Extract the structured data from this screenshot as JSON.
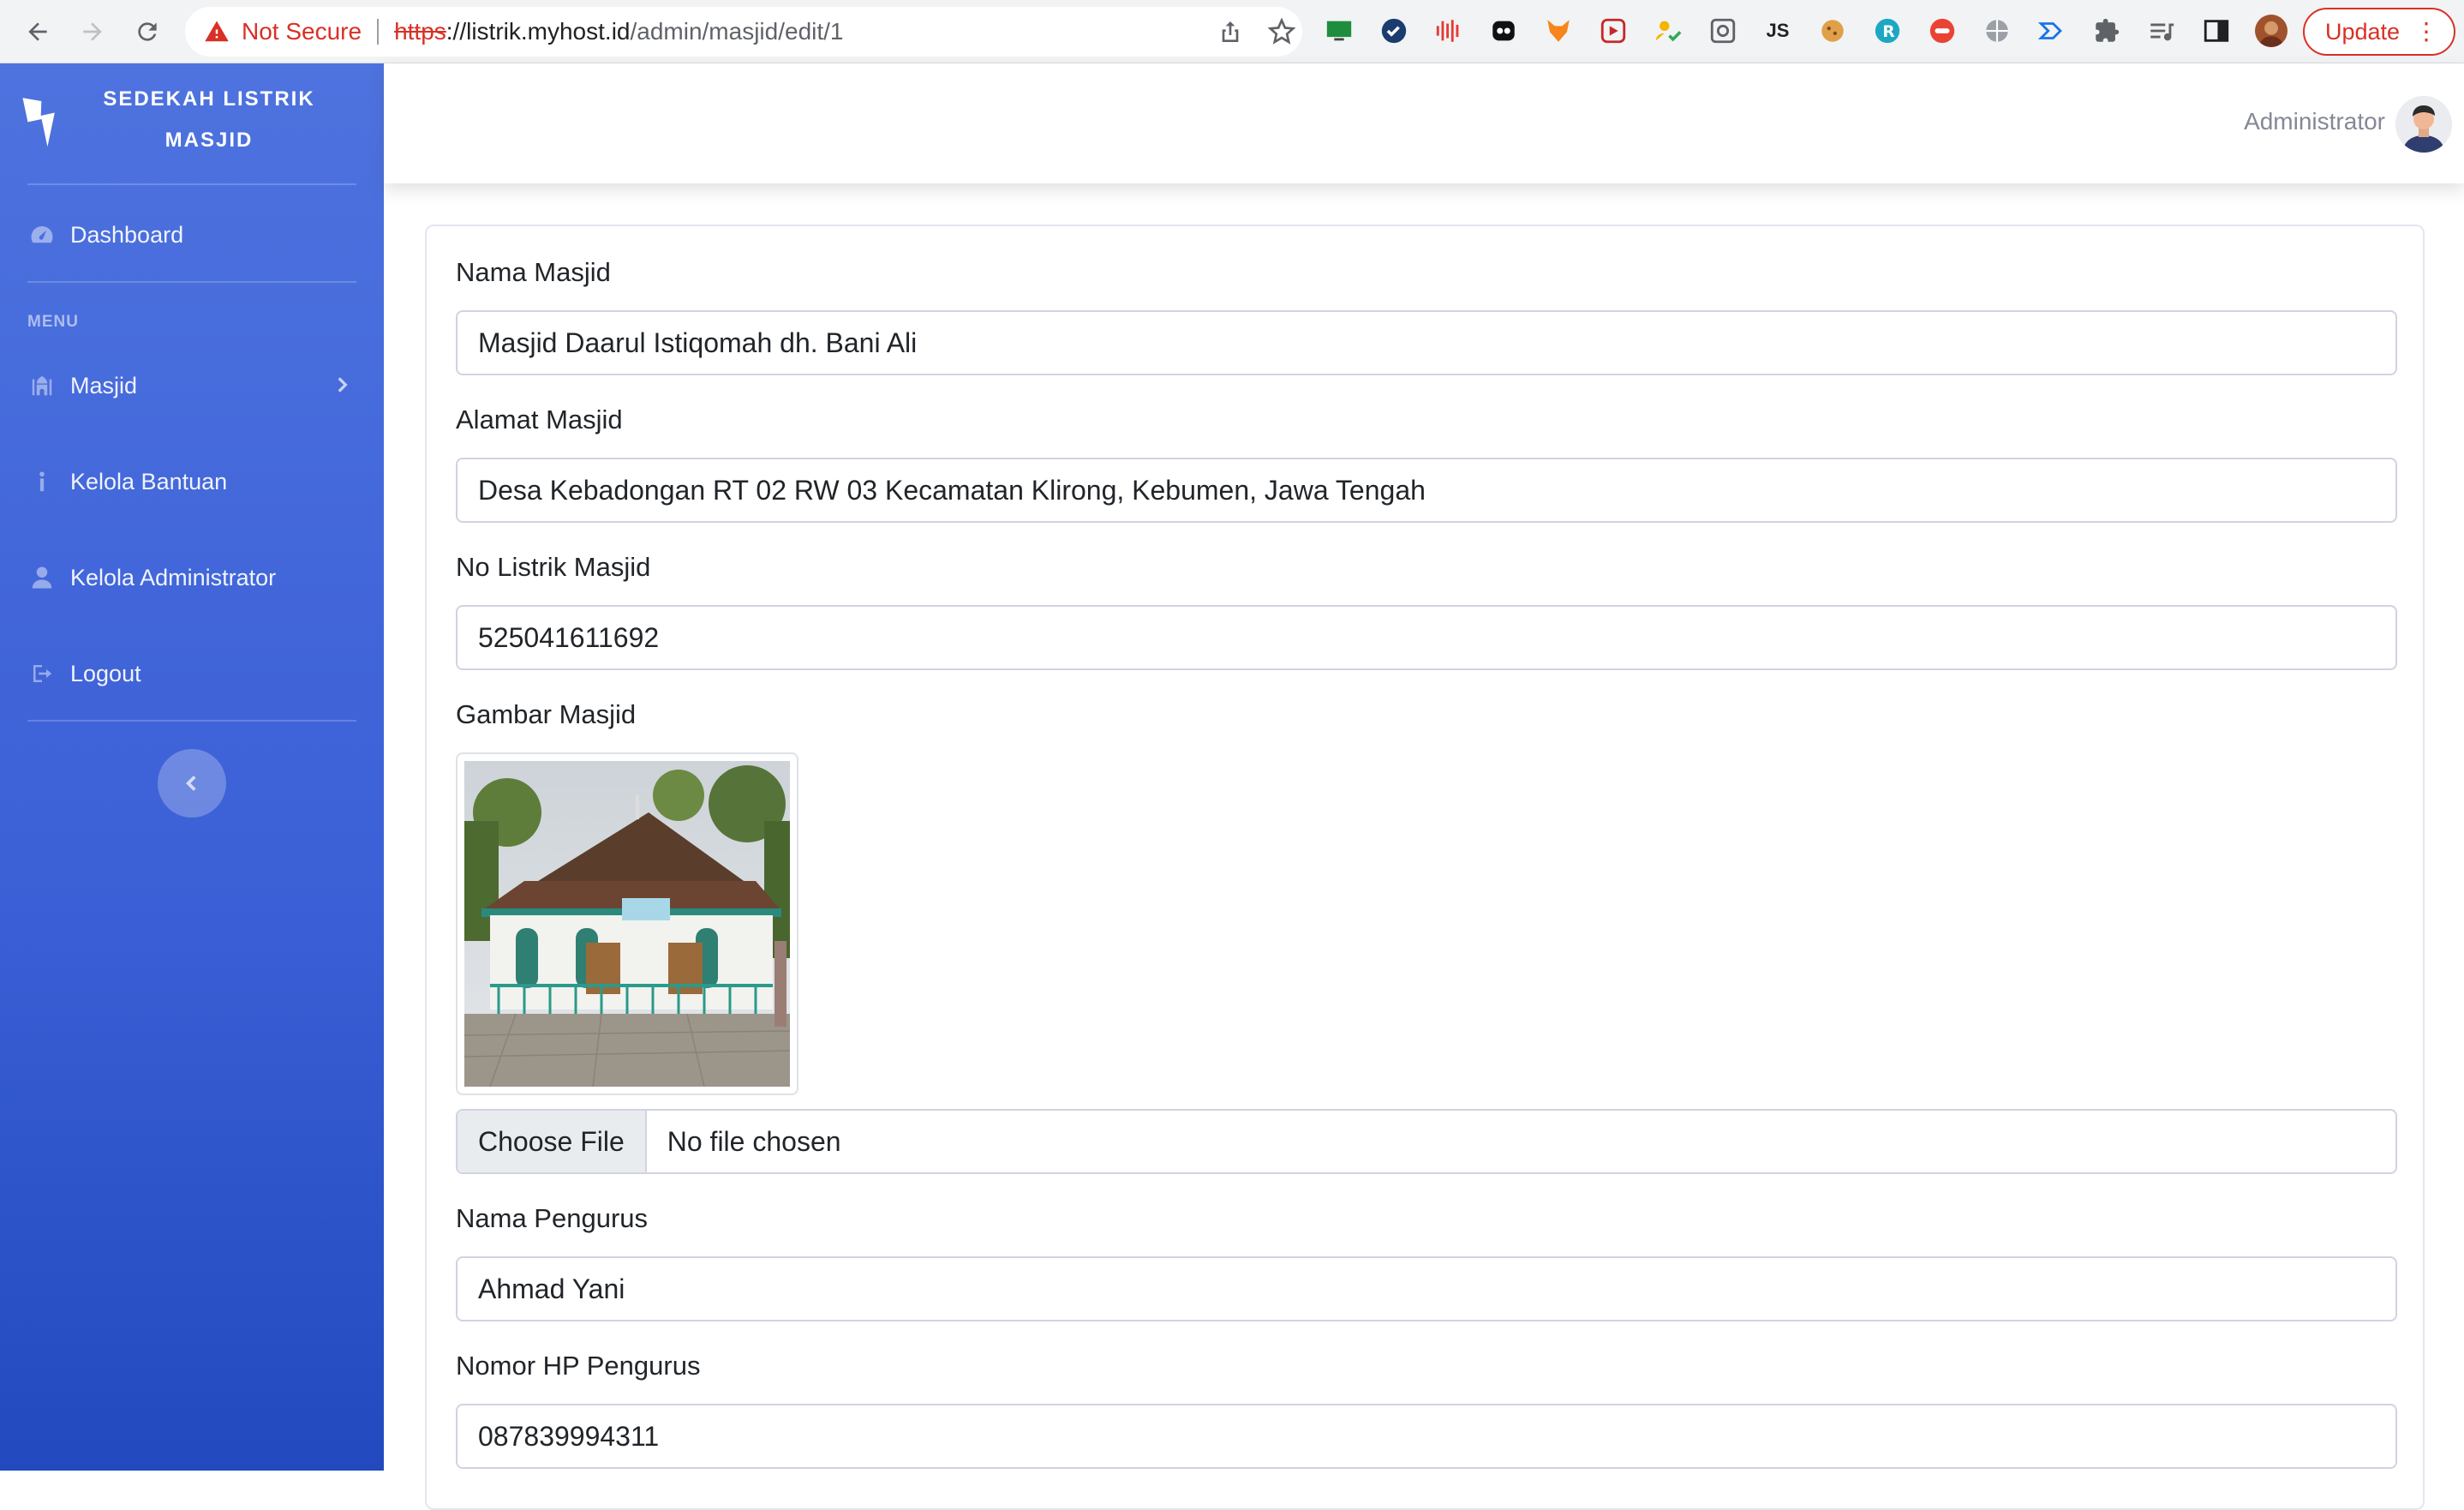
{
  "browser": {
    "security_label": "Not Secure",
    "url_scheme": "https",
    "url_host": "://listrik.myhost.id",
    "url_path": "/admin/masjid/edit/1",
    "update_label": "Update",
    "ext_js_label": "JS"
  },
  "sidebar": {
    "brand_line1": "SEDEKAH LISTRIK",
    "brand_line2": "MASJID",
    "dashboard_label": "Dashboard",
    "heading": "MENU",
    "items": [
      {
        "label": "Masjid",
        "icon": "mosque-icon"
      },
      {
        "label": "Kelola Bantuan",
        "icon": "info-icon"
      },
      {
        "label": "Kelola Administrator",
        "icon": "user-icon"
      },
      {
        "label": "Logout",
        "icon": "sign-out-icon"
      }
    ],
    "colors": {
      "gradient_top": "#4e73df",
      "gradient_bottom": "#224abe"
    }
  },
  "topbar": {
    "user_name": "Administrator"
  },
  "form": {
    "nama_masjid": {
      "label": "Nama Masjid",
      "value": "Masjid Daarul Istiqomah dh. Bani Ali"
    },
    "alamat_masjid": {
      "label": "Alamat Masjid",
      "value": "Desa Kebadongan RT 02 RW 03 Kecamatan Klirong, Kebumen, Jawa Tengah"
    },
    "no_listrik": {
      "label": "No Listrik Masjid",
      "value": "525041611692"
    },
    "gambar": {
      "label": "Gambar Masjid",
      "choose_label": "Choose File",
      "status": "No file chosen"
    },
    "nama_pengurus": {
      "label": "Nama Pengurus",
      "value": "Ahmad Yani"
    },
    "hp_pengurus": {
      "label": "Nomor HP Pengurus",
      "value": "087839994311"
    }
  }
}
